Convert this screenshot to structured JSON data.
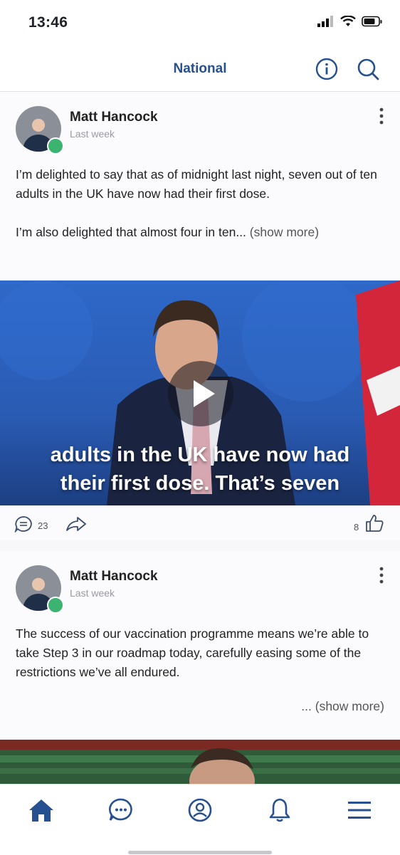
{
  "status_bar": {
    "time": "13:46"
  },
  "header": {
    "title": "National"
  },
  "posts": [
    {
      "author": "Matt Hancock",
      "time": "Last week",
      "text_p1": "I’m delighted to say that as of midnight last night, seven out of ten adults in the UK have now had their first dose.",
      "text_p2": "I’m also delighted that almost four in ten...",
      "show_more": "(show more)",
      "video_caption_line1": "adults in the UK have now had",
      "video_caption_line2": "their first dose. That’s seven",
      "comments": "23",
      "likes": "8"
    },
    {
      "author": "Matt Hancock",
      "time": "Last week",
      "text": "The success of our vaccination programme means we’re able to take Step 3 in our roadmap today, carefully easing some of the restrictions we’ve all endured.",
      "show_more": "... (show more)"
    }
  ],
  "colors": {
    "accent": "#26508f",
    "verified": "#3cb371"
  },
  "tab_bar": [
    "home-icon",
    "chat-icon",
    "profile-icon",
    "bell-icon",
    "menu-icon"
  ]
}
